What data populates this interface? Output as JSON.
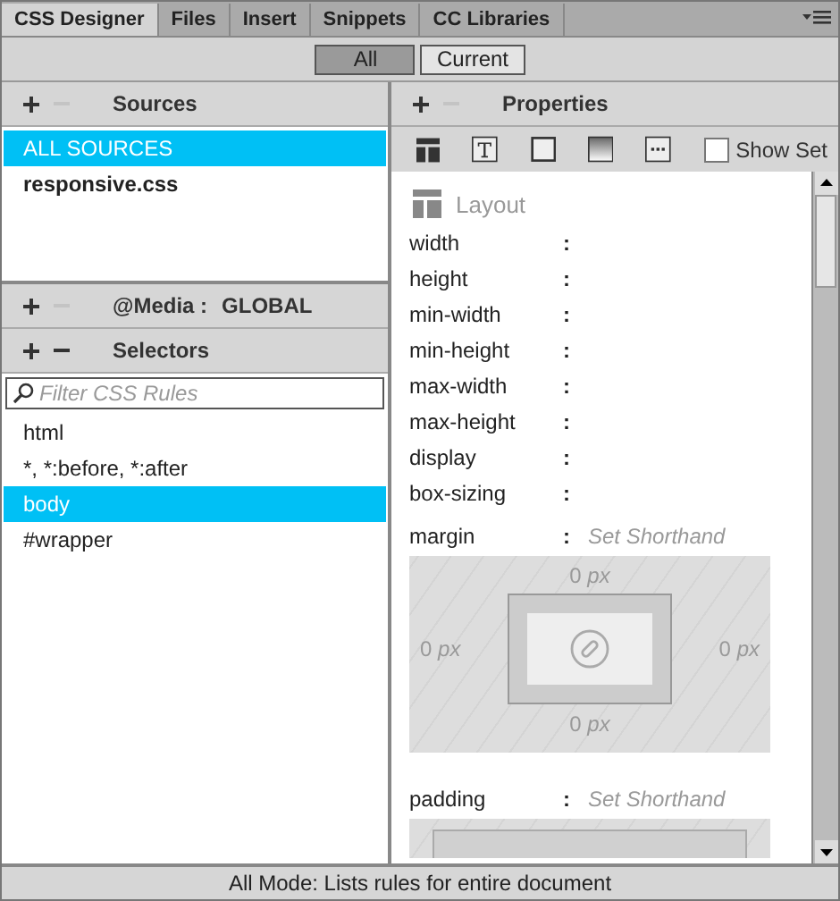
{
  "tabs": [
    {
      "label": "CSS Designer",
      "selected": true
    },
    {
      "label": "Files",
      "selected": false
    },
    {
      "label": "Insert",
      "selected": false
    },
    {
      "label": "Snippets",
      "selected": false
    },
    {
      "label": "CC Libraries",
      "selected": false
    }
  ],
  "mode_buttons": [
    {
      "label": "All",
      "selected": true
    },
    {
      "label": "Current",
      "selected": false
    }
  ],
  "sources": {
    "title": "Sources",
    "items": [
      {
        "label": "ALL SOURCES",
        "selected": true,
        "bold": false
      },
      {
        "label": "responsive.css",
        "selected": false,
        "bold": true
      }
    ]
  },
  "media": {
    "label": "@Media :",
    "value": "GLOBAL"
  },
  "selectors": {
    "title": "Selectors",
    "placeholder": "Filter CSS Rules",
    "items": [
      {
        "label": "html",
        "selected": false
      },
      {
        "label": "*, *:before, *:after",
        "selected": false
      },
      {
        "label": "body",
        "selected": true
      },
      {
        "label": "#wrapper",
        "selected": false
      }
    ]
  },
  "properties": {
    "title": "Properties",
    "show_set": {
      "label": "Show Set",
      "checked": false
    },
    "section": "Layout",
    "rows": [
      {
        "name": "width",
        "sep": ":"
      },
      {
        "name": "height",
        "sep": ":"
      },
      {
        "name": "min-width",
        "sep": ":"
      },
      {
        "name": "min-height",
        "sep": ":"
      },
      {
        "name": "max-width",
        "sep": ":"
      },
      {
        "name": "max-height",
        "sep": ":"
      },
      {
        "name": "display",
        "sep": ":"
      },
      {
        "name": "box-sizing",
        "sep": ":"
      }
    ],
    "margin": {
      "name": "margin",
      "sep": ":",
      "hint": "Set Shorthand",
      "top": {
        "value": "0",
        "unit": "px"
      },
      "right": {
        "value": "0",
        "unit": "px"
      },
      "bottom": {
        "value": "0",
        "unit": "px"
      },
      "left": {
        "value": "0",
        "unit": "px"
      }
    },
    "padding": {
      "name": "padding",
      "sep": ":",
      "hint": "Set Shorthand"
    }
  },
  "status_bar": "All Mode: Lists rules for entire document"
}
